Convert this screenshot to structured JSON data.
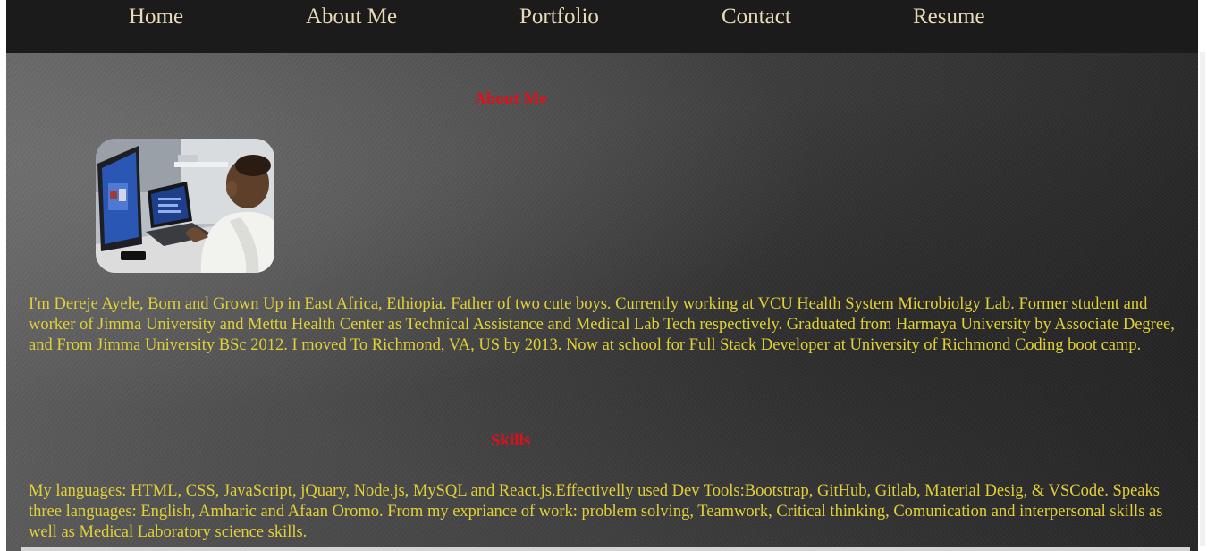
{
  "nav": {
    "items": [
      {
        "label": "Home"
      },
      {
        "label": "About Me"
      },
      {
        "label": "Portfolio"
      },
      {
        "label": "Contact"
      },
      {
        "label": "Resume"
      }
    ]
  },
  "about": {
    "heading": "About Me",
    "photo_icon": "profile-photo",
    "bio": "I'm Dereje Ayele, Born and Grown Up in East Africa, Ethiopia. Father of two cute boys. Currently working at VCU Health System Microbiolgy Lab. Former student and worker of Jimma University and Mettu Health Center as Technical Assistance and Medical Lab Tech respectively. Graduated from Harmaya University by Associate Degree, and From Jimma University BSc 2012. I moved To Richmond, VA, US by 2013. Now at school for Full Stack Developer at University of Richmond Coding boot camp."
  },
  "skills": {
    "heading": "Skills",
    "text": "My languages: HTML, CSS, JavaScript, jQuary, Node.js, MySQL and React.js.Effectivelly used Dev Tools:Bootstrap, GitHub, Gitlab, Material Desig, & VSCode. Speaks three languages: English, Amharic and Afaan Oromo. From my expriance of work: problem solving, Teamwork, Critical thinking, Comunication and interpersonal skills as well as Medical Laboratory science skills."
  },
  "colors": {
    "nav_background": "#1b1b1b",
    "nav_text": "#e8d9b8",
    "heading": "#e0101a",
    "body_text": "#e2d038"
  }
}
